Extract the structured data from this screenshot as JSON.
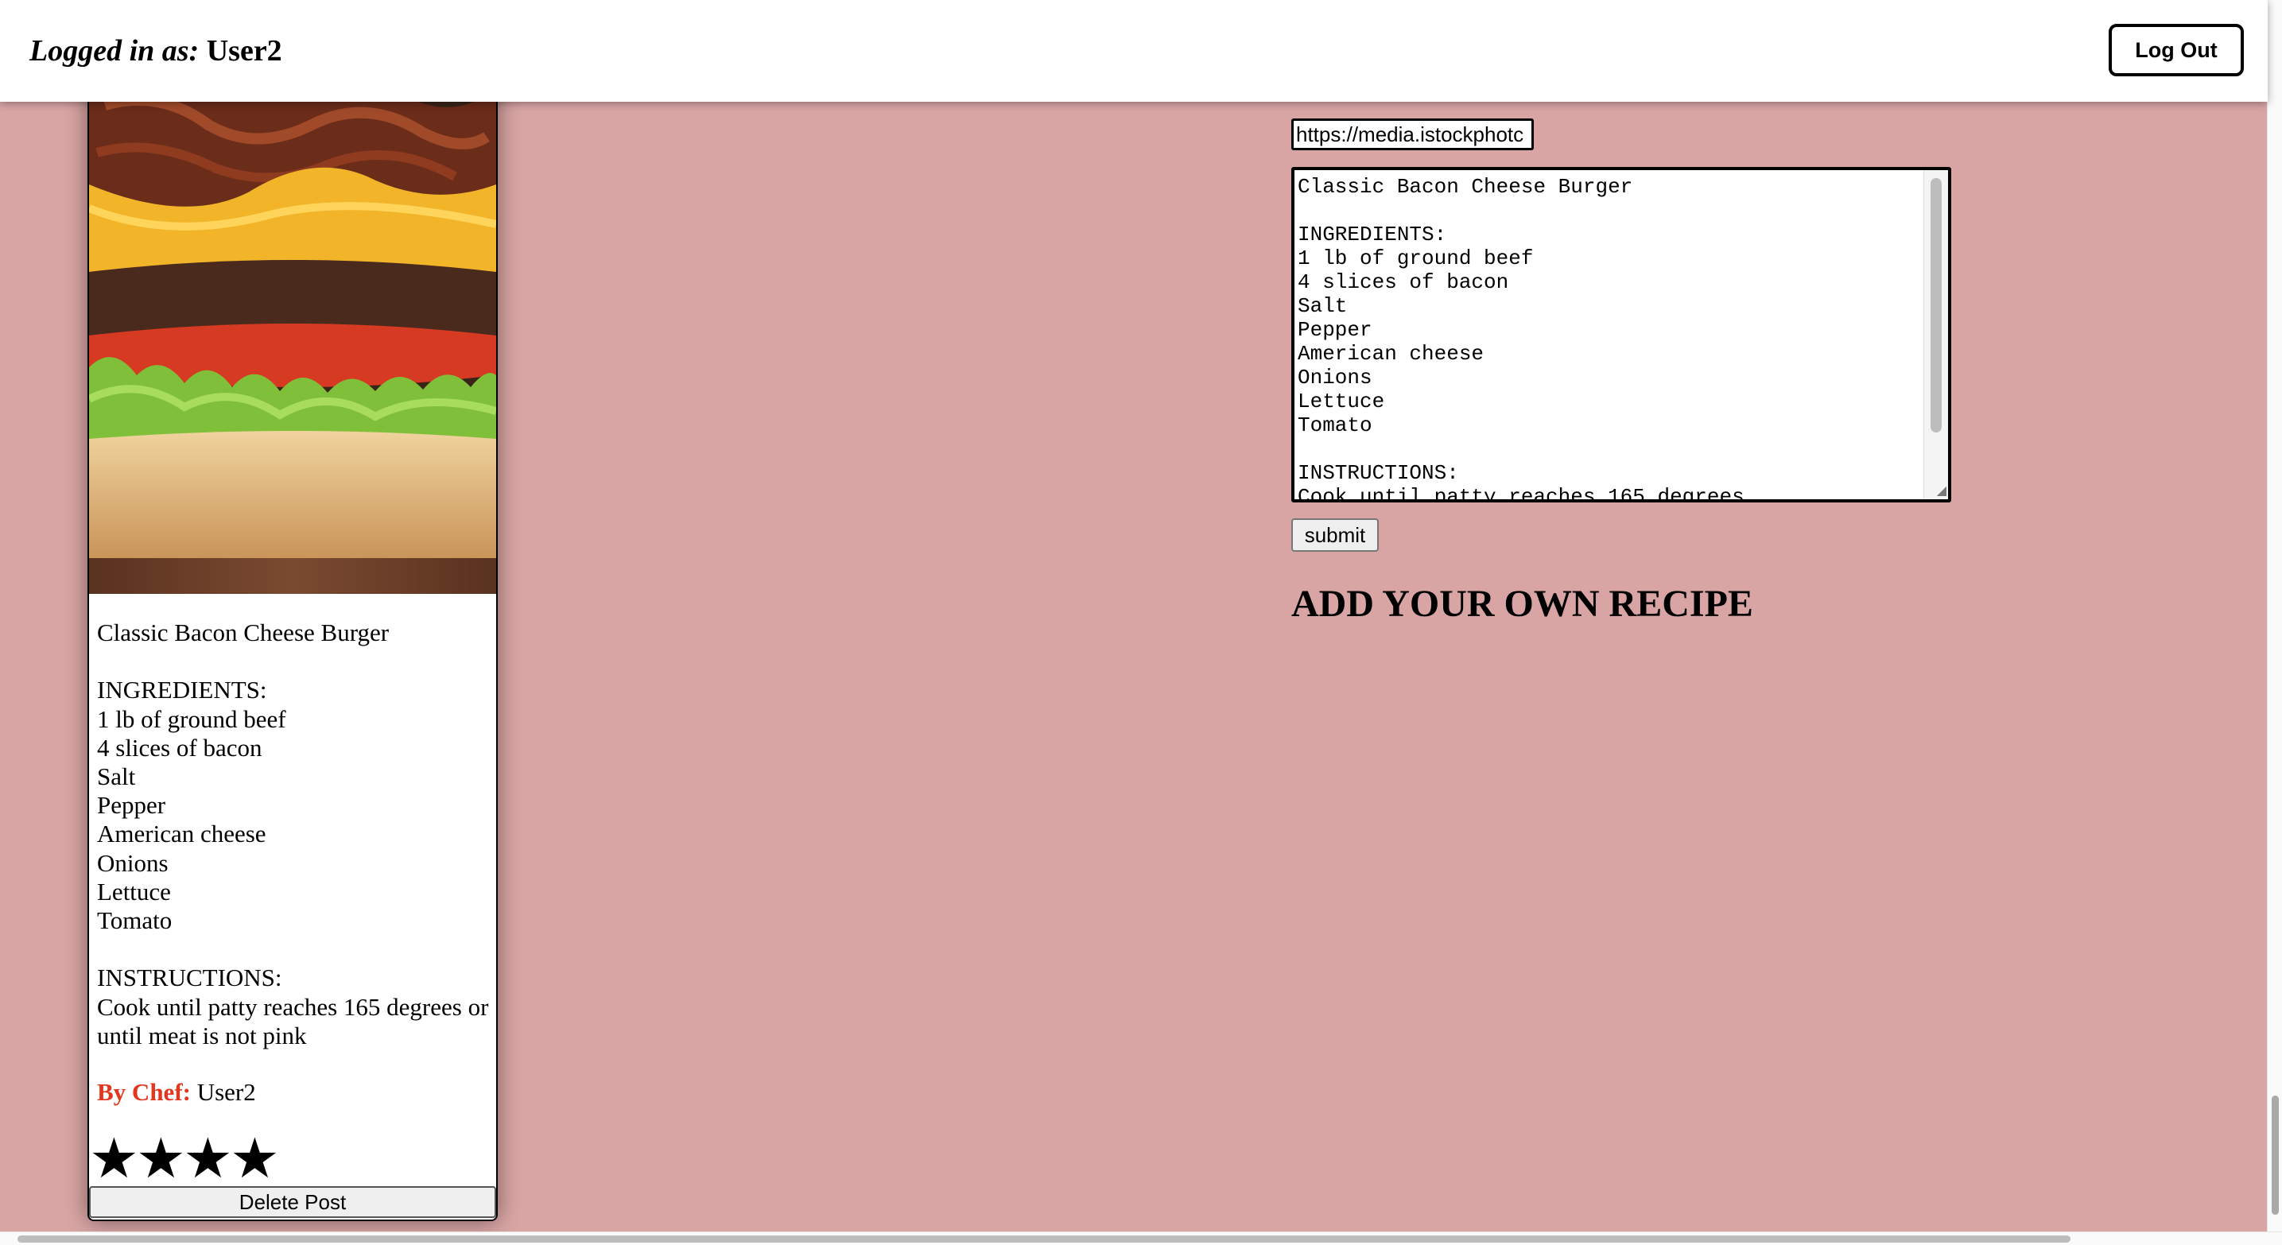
{
  "header": {
    "login_prefix": "Logged in as:",
    "username": "User2",
    "logout_label": "Log Out"
  },
  "recipe_card": {
    "image_alt": "bacon cheeseburger photo",
    "text": "Classic Bacon Cheese Burger\n\nINGREDIENTS:\n1 lb of ground beef\n4 slices of bacon\nSalt\nPepper\nAmerican cheese\nOnions\nLettuce\nTomato\n\nINSTRUCTIONS:\nCook until patty reaches 165 degrees or until meat is not pink",
    "chef_label": "By Chef:",
    "chef_name": "User2",
    "rating": {
      "stars": 4,
      "glyph": "★"
    },
    "delete_label": "Delete Post"
  },
  "form": {
    "url_value": "https://media.istockphotc",
    "textarea_value": "Classic Bacon Cheese Burger\n\nINGREDIENTS:\n1 lb of ground beef\n4 slices of bacon\nSalt\nPepper\nAmerican cheese\nOnions\nLettuce\nTomato\n\nINSTRUCTIONS:\nCook until patty reaches 165 degrees",
    "submit_label": "submit",
    "heading": "ADD YOUR OWN RECIPE"
  },
  "colors": {
    "page_background": "#d8a5a4",
    "chef_label": "#e2361f",
    "header_background": "#ffffff"
  }
}
